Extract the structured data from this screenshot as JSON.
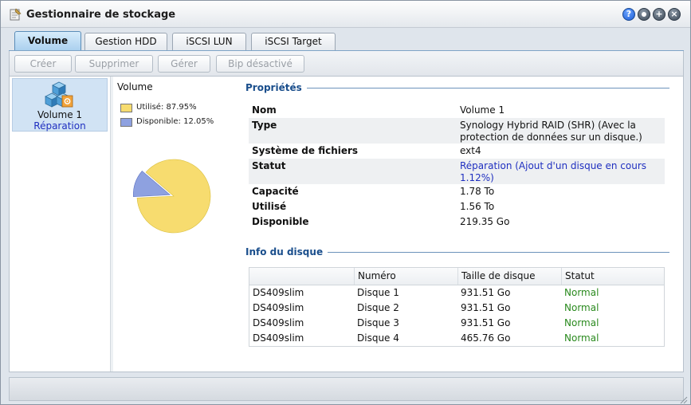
{
  "window": {
    "title": "Gestionnaire de stockage",
    "help_glyph": "?",
    "max_glyph": "+",
    "close_glyph": "×"
  },
  "tabs": [
    {
      "label": "Volume",
      "active": true
    },
    {
      "label": "Gestion HDD",
      "active": false
    },
    {
      "label": "iSCSI LUN",
      "active": false
    },
    {
      "label": "iSCSI Target",
      "active": false
    }
  ],
  "toolbar": {
    "create_label": "Créer",
    "delete_label": "Supprimer",
    "manage_label": "Gérer",
    "beep_label": "Bip désactivé"
  },
  "volume_list": [
    {
      "name": "Volume 1",
      "status": "Réparation"
    }
  ],
  "chart": {
    "title": "Volume",
    "legend": [
      {
        "label": "Utilisé: 87.95%",
        "color": "#f7dc6f"
      },
      {
        "label": "Disponible: 12.05%",
        "color": "#8ea1e0"
      }
    ]
  },
  "chart_data": {
    "type": "pie",
    "title": "Volume",
    "categories": [
      "Utilisé",
      "Disponible"
    ],
    "values": [
      87.95,
      12.05
    ],
    "colors": [
      "#f7dc6f",
      "#8ea1e0"
    ],
    "exploded": "Disponible"
  },
  "properties": {
    "title": "Propriétés",
    "rows": [
      {
        "label": "Nom",
        "value": "Volume 1"
      },
      {
        "label": "Type",
        "value": "Synology Hybrid RAID (SHR) (Avec la protection de données sur un disque.)"
      },
      {
        "label": "Système de fichiers",
        "value": "ext4"
      },
      {
        "label": "Statut",
        "value": "Réparation (Ajout d'un disque en cours 1.12%)"
      },
      {
        "label": "Capacité",
        "value": "1.78 To"
      },
      {
        "label": "Utilisé",
        "value": "1.56 To"
      },
      {
        "label": "Disponible",
        "value": "219.35 Go"
      }
    ]
  },
  "disks": {
    "title": "Info du disque",
    "headers": [
      "",
      "Numéro",
      "Taille de disque",
      "Statut"
    ],
    "rows": [
      {
        "device": "DS409slim",
        "number": "Disque 1",
        "size": "931.51 Go",
        "status": "Normal"
      },
      {
        "device": "DS409slim",
        "number": "Disque 2",
        "size": "931.51 Go",
        "status": "Normal"
      },
      {
        "device": "DS409slim",
        "number": "Disque 3",
        "size": "931.51 Go",
        "status": "Normal"
      },
      {
        "device": "DS409slim",
        "number": "Disque 4",
        "size": "465.76 Go",
        "status": "Normal"
      }
    ]
  },
  "icons": {
    "app": "storage-manager-icon",
    "volume": "volume-cubes-icon",
    "help": "help-icon",
    "minimize": "minimize-icon",
    "maximize": "maximize-icon",
    "close": "close-icon"
  }
}
